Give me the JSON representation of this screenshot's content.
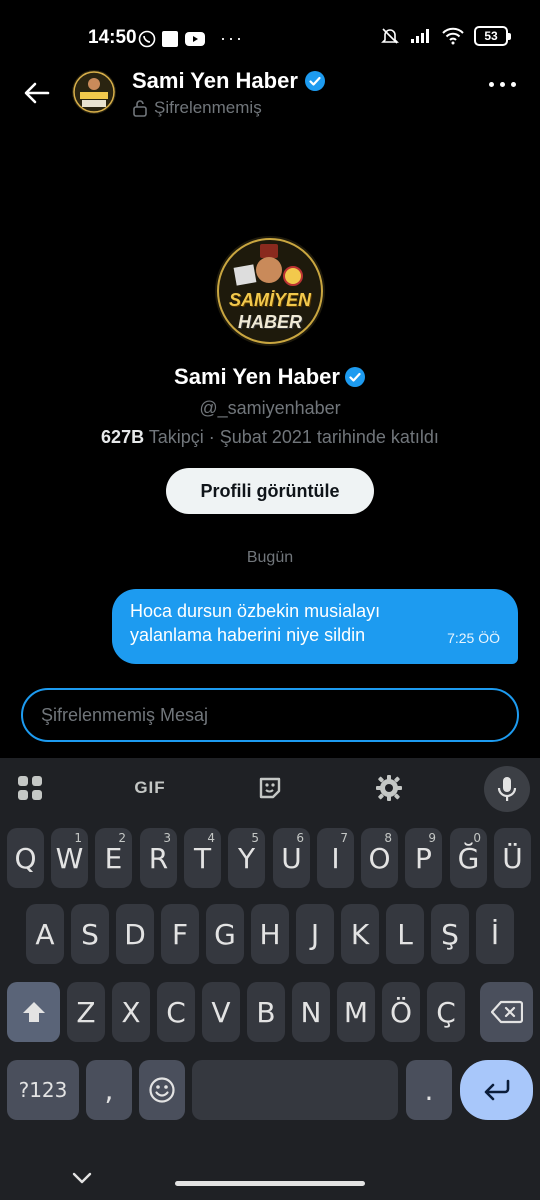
{
  "status_bar": {
    "time": "14:50",
    "battery": "53"
  },
  "header": {
    "name": "Sami Yen Haber",
    "subtitle": "Şifrelenmemiş"
  },
  "profile": {
    "avatar_text_top": "SAMİYEN",
    "avatar_text_bottom": "HABER",
    "name": "Sami Yen Haber",
    "handle": "@_samiyenhaber",
    "followers_count": "627B",
    "followers_meta": "Takipçi · Şubat 2021 tarihinde katıldı",
    "view_button": "Profili görüntüle"
  },
  "chat": {
    "date_separator": "Bugün",
    "messages": [
      {
        "text_line1": "Hoca dursun özbekin musialayı",
        "text_line2": "yalanlama haberini niye sildin",
        "time": "7:25 ÖÖ"
      }
    ]
  },
  "composer": {
    "placeholder": "Şifrelenmemiş Mesaj"
  },
  "keyboard": {
    "toolbar": {
      "gif": "GIF"
    },
    "row1": [
      "Q",
      "W",
      "E",
      "R",
      "T",
      "Y",
      "U",
      "I",
      "O",
      "P",
      "Ğ",
      "Ü"
    ],
    "row1_hints": [
      "",
      "1",
      "2",
      "3",
      "4",
      "5",
      "6",
      "7",
      "8",
      "9",
      "0",
      ""
    ],
    "row2": [
      "A",
      "S",
      "D",
      "F",
      "G",
      "H",
      "J",
      "K",
      "L",
      "Ş",
      "İ"
    ],
    "row3": [
      "Z",
      "X",
      "C",
      "V",
      "B",
      "N",
      "M",
      "Ö",
      "Ç"
    ],
    "row4": {
      "symbols": "?123",
      "comma": ",",
      "period": "."
    }
  },
  "colors": {
    "accent": "#1d9bf0",
    "background": "#000000",
    "keyboard": "#1f2125"
  }
}
